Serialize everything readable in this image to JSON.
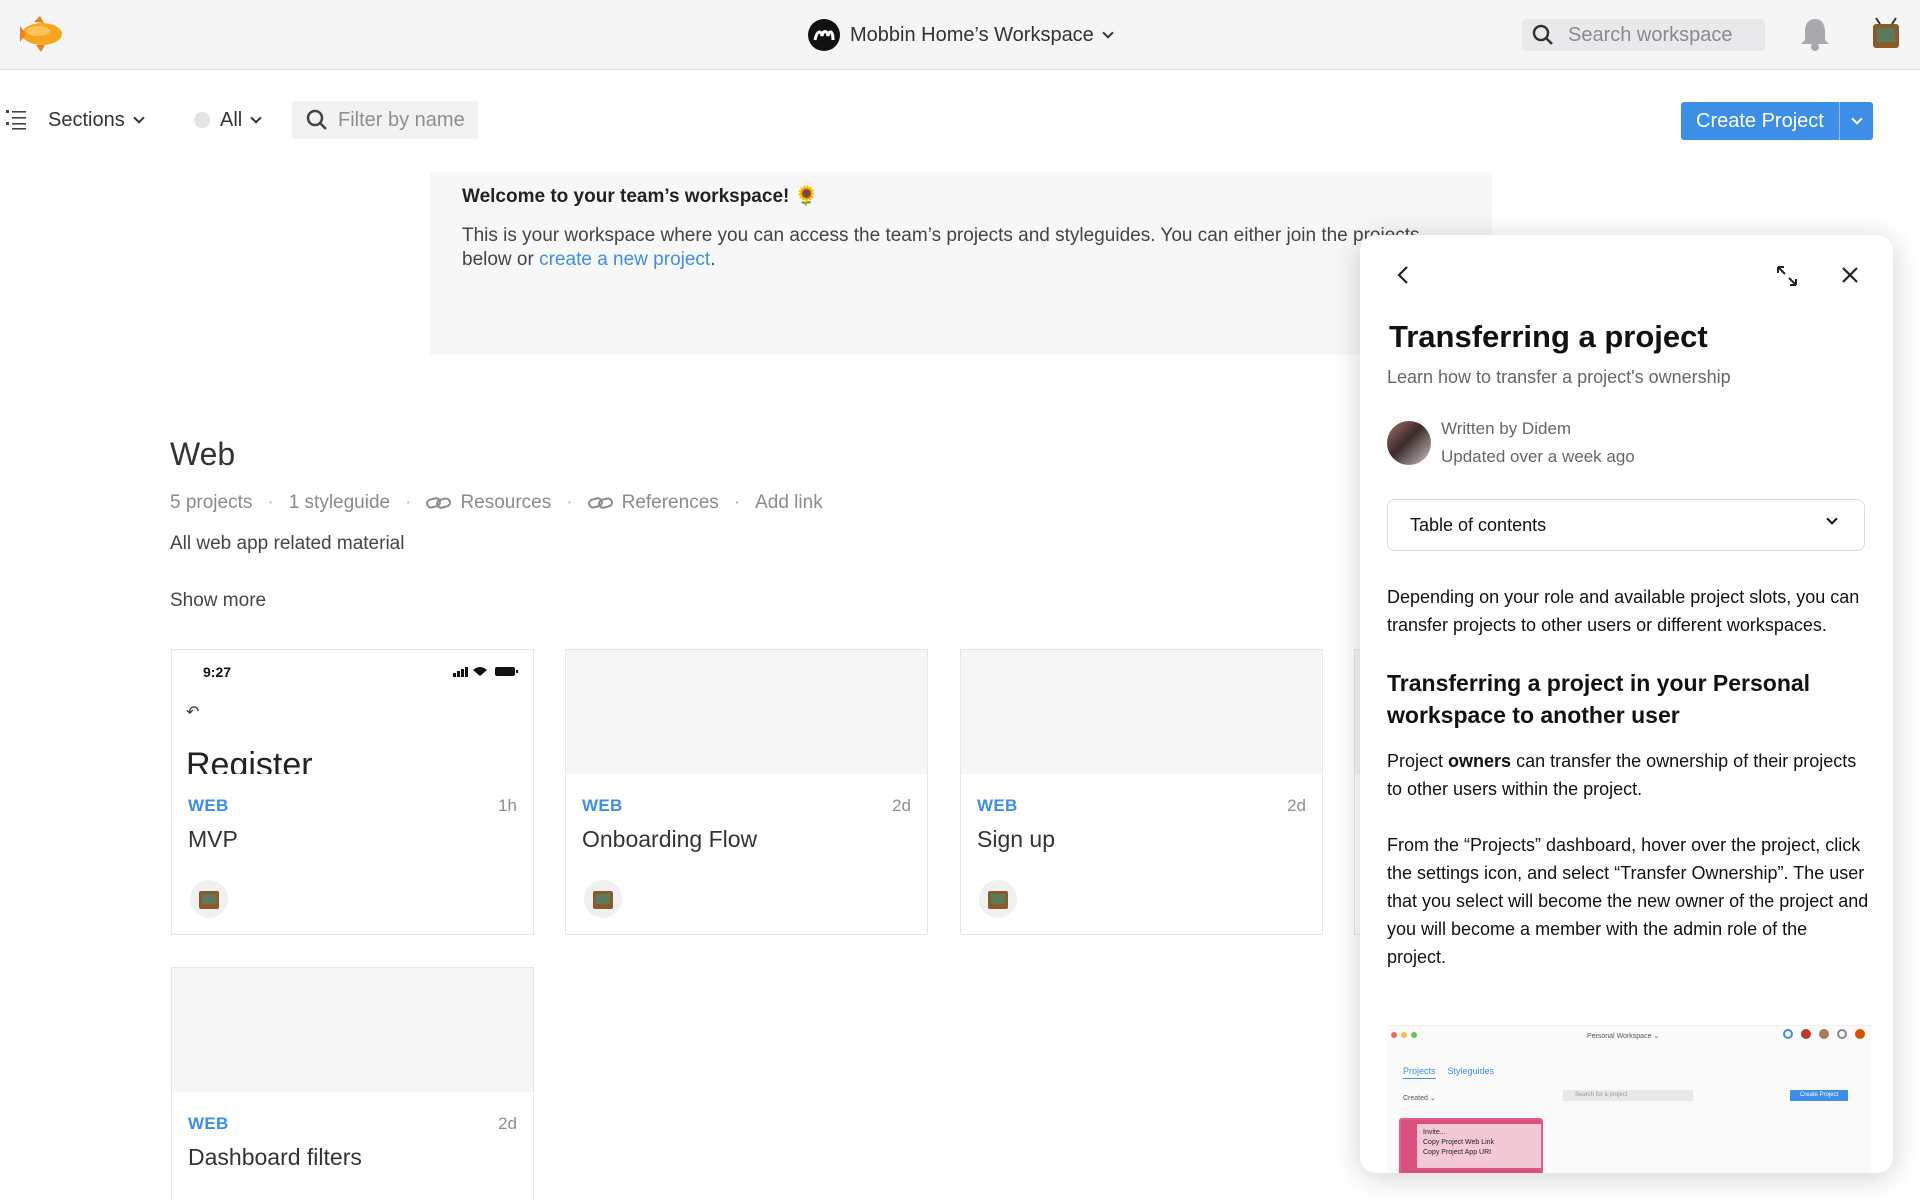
{
  "header": {
    "workspace_name": "Mobbin Home’s Workspace",
    "search_placeholder": "Search workspace"
  },
  "toolbar": {
    "sections_label": "Sections",
    "filter_all_label": "All",
    "filter_placeholder": "Filter by name",
    "create_project_label": "Create Project"
  },
  "welcome": {
    "title": "Welcome to your team’s workspace! 🌻",
    "text_before_link": "This is your workspace where you can access the team’s projects and styleguides. You can either join the projects below or ",
    "link_text": "create a new project",
    "text_after_link": "."
  },
  "section": {
    "title": "Web",
    "projects_count": "5 projects",
    "styleguides_count": "1 styleguide",
    "resources_label": "Resources",
    "references_label": "References",
    "add_link_label": "Add link",
    "description": "All web app related material",
    "show_more_label": "Show more"
  },
  "projects": [
    {
      "platform": "WEB",
      "name": "MVP",
      "updated": "1h",
      "thumb_time": "9:27",
      "thumb_title": "Register"
    },
    {
      "platform": "WEB",
      "name": "Onboarding Flow",
      "updated": "2d"
    },
    {
      "platform": "WEB",
      "name": "Sign up",
      "updated": "2d"
    },
    {
      "platform": "WEB",
      "name": "Dashboard filters",
      "updated": "2d"
    }
  ],
  "help_panel": {
    "title": "Transferring a project",
    "subtitle": "Learn how to transfer a project's ownership",
    "author_line": "Written by Didem",
    "updated_line": "Updated over a week ago",
    "toc_label": "Table of contents",
    "intro": "Depending on your role and available project slots, you can transfer projects to other users or different workspaces.",
    "heading": "Transferring a project in your Personal workspace to another user",
    "para1_before": "Project ",
    "para1_bold": "owners",
    "para1_after": " can transfer the ownership of their projects to other users within the project.",
    "para2": "From the “Projects” dashboard, hover over the project, click the settings icon, and select “Transfer Ownership”. The user that you select will become the new owner of the project and you will become a member with the admin role of the project.",
    "screenshot": {
      "workspace_label": "Personal Workspace ⌄",
      "tab_projects": "Projects",
      "tab_styleguides": "Styleguides",
      "created_label": "Created ⌄",
      "search_placeholder": "Search for a project",
      "create_label": "Create Project",
      "menu_item_1": "Invite...",
      "menu_item_2": "Copy Project Web Link",
      "menu_item_3": "Copy Project App URI"
    }
  },
  "colors": {
    "accent": "#3d8ee6",
    "topbar_bg": "#f5f5f6"
  }
}
